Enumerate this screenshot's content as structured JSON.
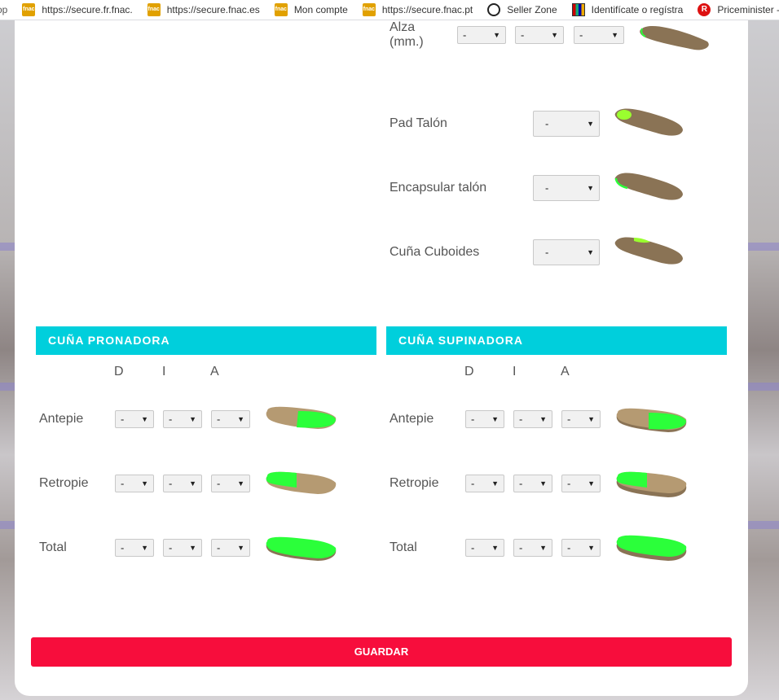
{
  "bookmarks": [
    {
      "label": "op",
      "icon": "none"
    },
    {
      "label": "https://secure.fr.fnac.",
      "icon": "fnac"
    },
    {
      "label": "https://secure.fnac.es",
      "icon": "fnac"
    },
    {
      "label": "Mon compte",
      "icon": "fnac"
    },
    {
      "label": "https://secure.fnac.pt",
      "icon": "fnac"
    },
    {
      "label": "Seller Zone",
      "icon": "seller-zone"
    },
    {
      "label": "Identifícate o regístra",
      "icon": "identificate"
    },
    {
      "label": "Priceminister -",
      "icon": "rakuten"
    }
  ],
  "fnac_icon_text": "fnac",
  "rakuten_icon_text": "R",
  "top_options": {
    "alza": {
      "label": "Alza (mm.)",
      "values": [
        "-",
        "-",
        "-"
      ]
    },
    "pad_talon": {
      "label": "Pad Talón",
      "value": "-"
    },
    "encapsular_talon": {
      "label": "Encapsular talón",
      "value": "-"
    },
    "cuna_cuboides": {
      "label": "Cuña Cuboides",
      "value": "-"
    }
  },
  "pronadora": {
    "title": "CUÑA PRONADORA",
    "columns": [
      "D",
      "I",
      "A"
    ],
    "rows": [
      {
        "label": "Antepie",
        "values": [
          "-",
          "-",
          "-"
        ]
      },
      {
        "label": "Retropie",
        "values": [
          "-",
          "-",
          "-"
        ]
      },
      {
        "label": "Total",
        "values": [
          "-",
          "-",
          "-"
        ]
      }
    ]
  },
  "supinadora": {
    "title": "CUÑA SUPINADORA",
    "columns": [
      "D",
      "I",
      "A"
    ],
    "rows": [
      {
        "label": "Antepie",
        "values": [
          "-",
          "-",
          "-"
        ]
      },
      {
        "label": "Retropie",
        "values": [
          "-",
          "-",
          "-"
        ]
      },
      {
        "label": "Total",
        "values": [
          "-",
          "-",
          "-"
        ]
      }
    ]
  },
  "save_label": "GUARDAR",
  "colors": {
    "accent": "#00cfdc",
    "save": "#f70d3c",
    "highlight": "#2bff3a",
    "insole": "#8a7355"
  }
}
